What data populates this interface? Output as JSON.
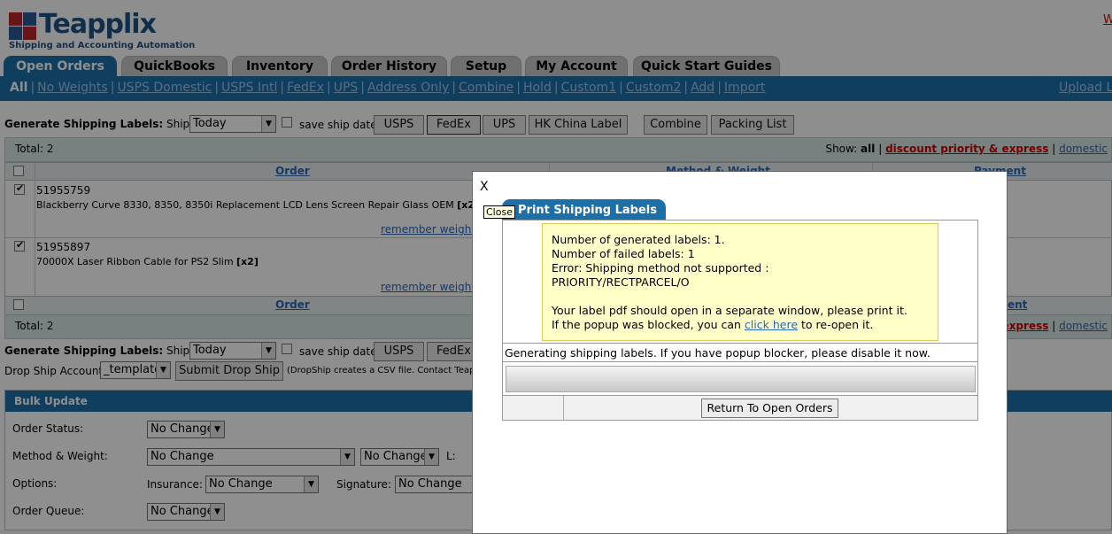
{
  "brand": {
    "name": "Teapplix",
    "tagline": "Shipping and Accounting Automation",
    "corner_link": "W"
  },
  "tabs": [
    {
      "label": "Open Orders"
    },
    {
      "label": "QuickBooks"
    },
    {
      "label": "Inventory"
    },
    {
      "label": "Order History"
    },
    {
      "label": "Setup"
    },
    {
      "label": "My Account"
    },
    {
      "label": "Quick Start Guides"
    }
  ],
  "subnav": {
    "items": [
      "All",
      "No Weights",
      "USPS Domestic",
      "USPS Intl",
      "FedEx",
      "UPS",
      "Address Only",
      "Combine",
      "Hold",
      "Custom1",
      "Custom2",
      "Add",
      "Import"
    ],
    "right": "Upload La"
  },
  "gen_top": {
    "label": "Generate Shipping Labels:",
    "ship_date_label": "Ship Date",
    "ship_date_value": "Today",
    "save_label": "save ship date",
    "buttons": [
      "USPS",
      "FedEx",
      "UPS",
      "HK China Label",
      "Combine",
      "Packing List"
    ]
  },
  "panel_top": {
    "total": "Total:  2",
    "show_label": "Show:",
    "show_all": "all",
    "sep": "|",
    "show_discount": "discount priority & express",
    "show_domestic": "domestic"
  },
  "grid": {
    "header_order": "Order",
    "header_method": "Method & Weight",
    "header_payment": "Payment",
    "orders": [
      {
        "id": "51955759",
        "desc": "Blackberry Curve 8330, 8350, 8350i Replacement LCD Lens Screen Repair Glass OEM",
        "qty": "[x2]",
        "remember": "remember weight"
      },
      {
        "id": "51955897",
        "desc": "70000X Laser Ribbon Cable for PS2 Slim",
        "qty": "[x2]",
        "remember": "remember weight"
      }
    ],
    "footer_order": "Order",
    "footer_payment": "ent"
  },
  "panel_bottom": {
    "total": "Total:  2",
    "express": "express",
    "domestic": "domestic"
  },
  "gen_bottom": {
    "label": "Generate Shipping Labels:",
    "ship_date_label": "Ship Date",
    "ship_date_value": "Today",
    "save_label": "save ship date",
    "buttons": [
      "USPS",
      "FedEx"
    ]
  },
  "dropship": {
    "label": "Drop Ship Account:",
    "value": "_template",
    "button": "Submit Drop Ship",
    "note": "(DropShip creates a CSV file. Contact Teapp"
  },
  "bulk": {
    "title": "Bulk Update",
    "order_status_label": "Order Status:",
    "order_status_value": "No Change",
    "method_label": "Method & Weight:",
    "method_value": "No Change",
    "method_value2": "No Change",
    "l_label": "L:",
    "options_label": "Options:",
    "insurance_label": "Insurance:",
    "insurance_value": "No Change",
    "signature_label": "Signature:",
    "signature_value": "No Change",
    "queue_label": "Order Queue:",
    "queue_value": "No Change"
  },
  "modal": {
    "close_x": "X",
    "close_tip": "Close",
    "tab_title": "Print Shipping Labels",
    "msg_generated": "Number of generated labels: 1.",
    "msg_failed": "Number of failed labels: 1",
    "msg_error": "Error: Shipping method not supported :",
    "msg_method": "PRIORITY/RECTPARCEL/O",
    "msg_pdf": "Your label pdf should open in a separate window, please print it.",
    "msg_popup_pre": "If the popup was blocked, you can",
    "msg_popup_link": "click here",
    "msg_popup_post": "to re-open it.",
    "generating": "Generating shipping labels. If you have popup blocker, please disable it now.",
    "return_button": "Return To Open Orders"
  }
}
